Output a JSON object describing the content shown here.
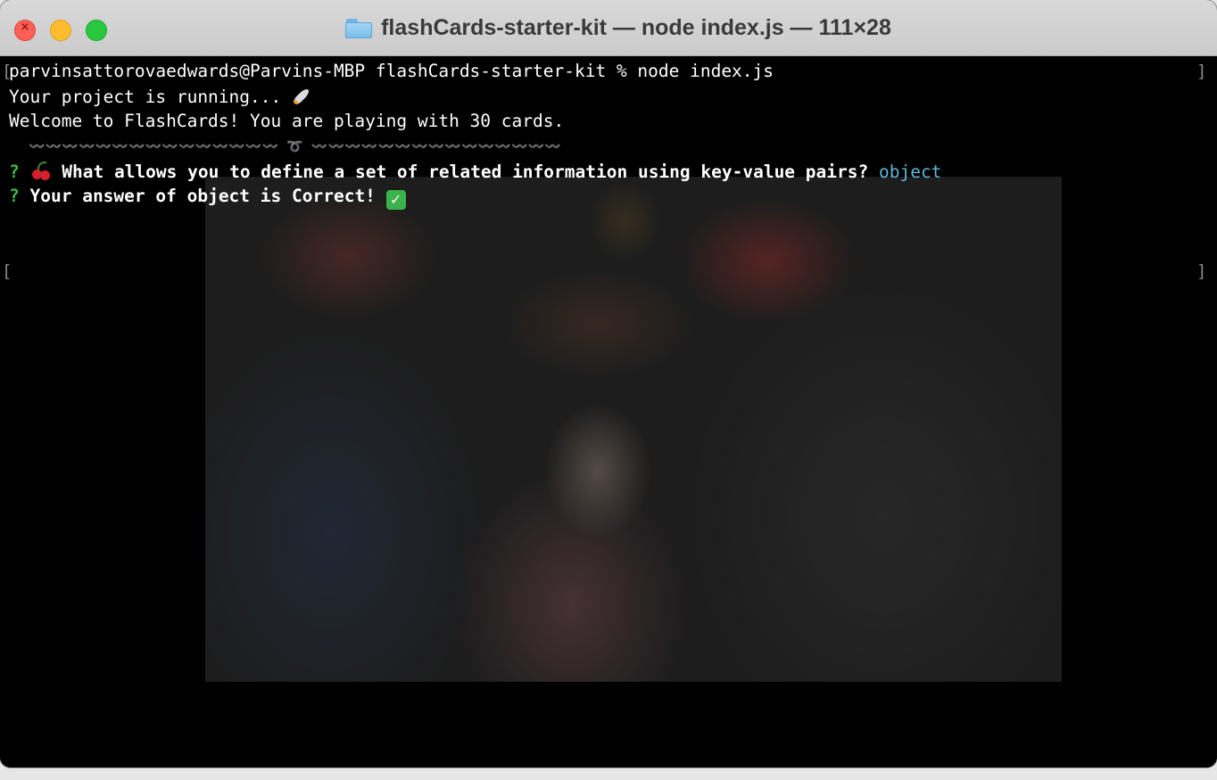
{
  "window": {
    "title": "flashCards-starter-kit — node index.js — 111×28"
  },
  "terminal": {
    "prompt_line": "parvinsattorovaedwards@Parvins-MBP flashCards-starter-kit % node index.js",
    "running_line": "Your project is running... ",
    "welcome_line": "Welcome to FlashCards! You are playing with 30 cards.",
    "divider_line": "〰️〰️〰️〰️〰️〰️〰️〰️〰️〰️〰️〰️〰️〰️〰️ ➰ 〰️〰️〰️〰️〰️〰️〰️〰️〰️〰️〰️〰️〰️〰️〰️",
    "question_mark": "?",
    "question_text": "What allows you to define a set of related information using key-value pairs?",
    "answer": "object",
    "result_text": "Your answer of object is Correct!",
    "bracket_left": "[",
    "bracket_right": "]"
  },
  "icons": {
    "folder": "folder-icon",
    "rocket": "rocket-emoji",
    "cherry": "cherry-emoji",
    "check": "check-mark-emoji"
  },
  "colors": {
    "terminal_bg": "#000000",
    "text": "#ffffff",
    "question_mark": "#3fb94a",
    "answer": "#5fb6d9",
    "close": "#ff5f57",
    "minimize": "#febc2e",
    "zoom": "#28c840"
  }
}
